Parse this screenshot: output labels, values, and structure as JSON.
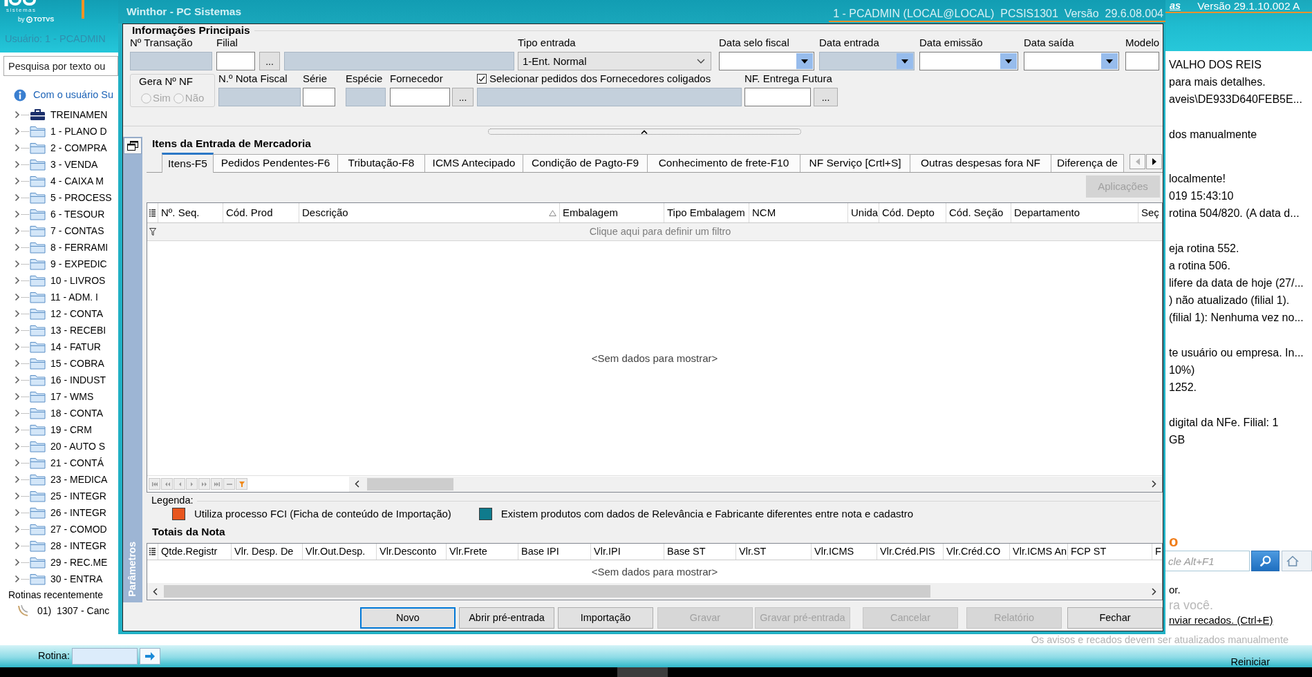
{
  "app_header": {
    "logo": {
      "tagline": "sistemas",
      "by": "by",
      "vendor": "TOTVS"
    },
    "link": "as",
    "version": "Versão 29.1.10.002 A"
  },
  "sidebar": {
    "user": "Usuário: 1 - PCADMIN",
    "search": {
      "placeholder": "Pesquisa por texto ou"
    },
    "notice": "Com o usuário Su",
    "tree": [
      {
        "label": "TREINAMEN",
        "kind": "company",
        "expanded": false
      },
      {
        "label": "1 - PLANO D",
        "kind": "folder",
        "expanded": false
      },
      {
        "label": "2 - COMPRA",
        "kind": "folder",
        "expanded": false
      },
      {
        "label": "3 - VENDA",
        "kind": "folder",
        "expanded": false
      },
      {
        "label": "4 - CAIXA M",
        "kind": "folder",
        "expanded": false
      },
      {
        "label": "5 - PROCESS",
        "kind": "folder",
        "expanded": false
      },
      {
        "label": "6 - TESOUR",
        "kind": "folder",
        "expanded": false
      },
      {
        "label": "7 - CONTAS",
        "kind": "folder",
        "expanded": false
      },
      {
        "label": "8 - FERRAMI",
        "kind": "folder",
        "expanded": false
      },
      {
        "label": "9 - EXPEDIC",
        "kind": "folder",
        "expanded": false
      },
      {
        "label": "10 - LIVROS",
        "kind": "folder",
        "expanded": false
      },
      {
        "label": "11 - ADM. I",
        "kind": "folder",
        "expanded": false
      },
      {
        "label": "12 - CONTA",
        "kind": "folder",
        "expanded": false
      },
      {
        "label": "13 - RECEBI",
        "kind": "folder",
        "expanded": false
      },
      {
        "label": "14 - FATUR",
        "kind": "folder",
        "expanded": false
      },
      {
        "label": "15 - COBRA",
        "kind": "folder",
        "expanded": false
      },
      {
        "label": "16 - INDUST",
        "kind": "folder",
        "expanded": false
      },
      {
        "label": "17 - WMS",
        "kind": "folder",
        "expanded": false
      },
      {
        "label": "18 - CONTA",
        "kind": "folder",
        "expanded": false
      },
      {
        "label": "19 - CRM",
        "kind": "folder",
        "expanded": false
      },
      {
        "label": "20 - AUTO S",
        "kind": "folder",
        "expanded": false
      },
      {
        "label": "21 - CONTÁ",
        "kind": "folder",
        "expanded": false
      },
      {
        "label": "23 - MEDICA",
        "kind": "folder",
        "expanded": false
      },
      {
        "label": "25 - INTEGR",
        "kind": "folder",
        "expanded": false
      },
      {
        "label": "26 - INTEGR",
        "kind": "folder",
        "expanded": false
      },
      {
        "label": "27 - COMOD",
        "kind": "folder",
        "expanded": false
      },
      {
        "label": "28 - INTEGR",
        "kind": "folder",
        "expanded": false
      },
      {
        "label": "29 - REC.ME",
        "kind": "folder",
        "expanded": false
      },
      {
        "label": "30 - ENTRA",
        "kind": "folder",
        "expanded": false
      }
    ],
    "recent_title": "Rotinas recentemente",
    "recent": [
      {
        "label": "01)  1307 - Canc"
      }
    ]
  },
  "dialog": {
    "title": "Winthor - PC Sistemas",
    "session": "1 - PCADMIN (LOCAL@LOCAL)  PCSIS1301  Versão  29.6.08.004",
    "main_info": {
      "title": "Informações Principais",
      "row_1": [
        {
          "kind": "text",
          "label": "Nº Transação",
          "disabled": true
        },
        {
          "kind": "text",
          "label": "Filial",
          "disabled": false
        },
        {
          "kind": "button",
          "text": "..."
        },
        {
          "kind": "text",
          "disabled": true
        },
        {
          "kind": "select",
          "label": "Tipo entrada",
          "value": "1-Ent. Normal"
        },
        {
          "kind": "date",
          "label": "Data selo fiscal",
          "disabled": false
        },
        {
          "kind": "date",
          "label": "Data entrada",
          "disabled": true
        },
        {
          "kind": "date",
          "label": "Data emissão",
          "disabled": false
        },
        {
          "kind": "date",
          "label": "Data saída",
          "disabled": false
        },
        {
          "kind": "text",
          "label": "Modelo",
          "disabled": false
        }
      ],
      "row_2": [
        {
          "kind": "radio_group",
          "title": "Gera Nº NF",
          "disabled": true,
          "options": [
            {
              "label": "Sim",
              "selected": false
            },
            {
              "label": "Não",
              "selected": false
            }
          ]
        },
        {
          "kind": "text",
          "label": "N.º Nota Fiscal",
          "disabled": true
        },
        {
          "kind": "text",
          "label": "Série",
          "disabled": false
        },
        {
          "kind": "text",
          "label": "Espécie",
          "disabled": true
        },
        {
          "kind": "text",
          "label": "Fornecedor",
          "disabled": false
        },
        {
          "kind": "button",
          "text": "..."
        },
        {
          "kind": "text",
          "disabled": true,
          "checkbox": {
            "label": "Selecionar pedidos dos Fornecedores coligados",
            "checked": true
          }
        },
        {
          "kind": "text",
          "label": "NF. Entrega Futura",
          "disabled": false
        },
        {
          "kind": "button",
          "text": "..."
        }
      ]
    },
    "items_panel": {
      "side_strip": "Parâmetros",
      "title": "Itens da Entrada de Mercadoria",
      "tabs": [
        {
          "label": "Itens-F5",
          "selected": true
        },
        {
          "label": "Pedidos Pendentes-F6",
          "selected": false
        },
        {
          "label": "Tributação-F8",
          "selected": false
        },
        {
          "label": "ICMS Antecipado",
          "selected": false
        },
        {
          "label": "Condição de Pagto-F9",
          "selected": false
        },
        {
          "label": "Conhecimento de frete-F10",
          "selected": false
        },
        {
          "label": "NF Serviço [Crtl+S]",
          "selected": false
        },
        {
          "label": "Outras despesas fora NF",
          "selected": false
        },
        {
          "label": "Diferença de",
          "selected": false
        }
      ],
      "apply_button": {
        "label": "Aplicações",
        "disabled": true
      },
      "grid": {
        "columns": [
          {
            "label": "Nº. Seq.",
            "sorted": false
          },
          {
            "label": "Cód. Prod",
            "sorted": false
          },
          {
            "label": "Descrição",
            "sorted": true
          },
          {
            "label": "Embalagem",
            "sorted": false
          },
          {
            "label": "Tipo Embalagem",
            "sorted": false
          },
          {
            "label": "NCM",
            "sorted": false
          },
          {
            "label": "Unida",
            "sorted": false
          },
          {
            "label": "Cód. Depto",
            "sorted": false
          },
          {
            "label": "Cód. Seção",
            "sorted": false
          },
          {
            "label": "Departamento",
            "sorted": false
          },
          {
            "label": "Seç",
            "sorted": false
          }
        ],
        "filter_hint": "Clique aqui para definir um filtro",
        "empty_text": "<Sem dados para mostrar>"
      }
    },
    "legend": {
      "title": "Legenda:",
      "items": [
        {
          "label": "Utiliza processo FCI (Ficha de conteúdo de Importação)",
          "color": "#e8561f"
        },
        {
          "label": "Existem produtos com dados de Relevância e Fabricante diferentes entre nota e cadastro",
          "color": "#0f7b8d"
        }
      ]
    },
    "totals": {
      "title": "Totais da Nota",
      "columns": [
        "Qtde.Registr",
        "Vlr. Desp. De",
        "Vlr.Out.Desp.",
        "Vlr.Desconto",
        "Vlr.Frete",
        "Base IPI",
        "Vlr.IPI",
        "Base ST",
        "Vlr.ST",
        "Vlr.ICMS",
        "Vlr.Créd.PIS",
        "Vlr.Créd.CO",
        "Vlr.ICMS An",
        "FCP ST",
        "F"
      ],
      "empty_text": "<Sem dados para mostrar>"
    },
    "buttons": [
      {
        "label": "Novo",
        "disabled": false,
        "default": true
      },
      {
        "label": "Abrir pré-entrada",
        "disabled": false,
        "default": false
      },
      {
        "label": "Importação",
        "disabled": false,
        "default": false
      },
      {
        "label": "Gravar",
        "disabled": true,
        "default": false
      },
      {
        "label": "Gravar pré-entrada",
        "disabled": true,
        "default": false
      },
      {
        "label": "Cancelar",
        "disabled": true,
        "default": false
      },
      {
        "label": "Relatório",
        "disabled": true,
        "default": false
      },
      {
        "label": "Fechar",
        "disabled": false,
        "default": false
      }
    ]
  },
  "right_panel": {
    "paragraphs": [
      [
        "VALHO DOS REIS",
        "para mais detalhes.",
        "aveis\\DE933D640FEB5E..."
      ],
      [
        "dos manualmente"
      ],
      [
        "localmente!",
        "019 15:43:10",
        "rotina 504/820. (A data d..."
      ],
      [
        "eja rotina 552.",
        "a rotina 506.",
        "lifere da data de hoje (27/...",
        ") não atualizado (filial 1).",
        "(filial 1): Nenhuma vez no..."
      ],
      [
        "te usuário ou empresa. In...",
        "10%)",
        "1252."
      ],
      [
        "digital da NFe. Filial: 1",
        "GB"
      ]
    ],
    "heading": "o",
    "search": {
      "placeholder": "cle Alt+F1"
    },
    "lines": [
      {
        "kind": "text",
        "text": "or."
      },
      {
        "kind": "subtitle",
        "text": "ra você."
      },
      {
        "kind": "link",
        "text": "nviar recados. (Ctrl+E)"
      }
    ],
    "footnote": "Os avisos e recados devem ser atualizados manualmente"
  },
  "footer": {
    "rotina_label": "Rotina:",
    "restart": "Reiniciar"
  }
}
